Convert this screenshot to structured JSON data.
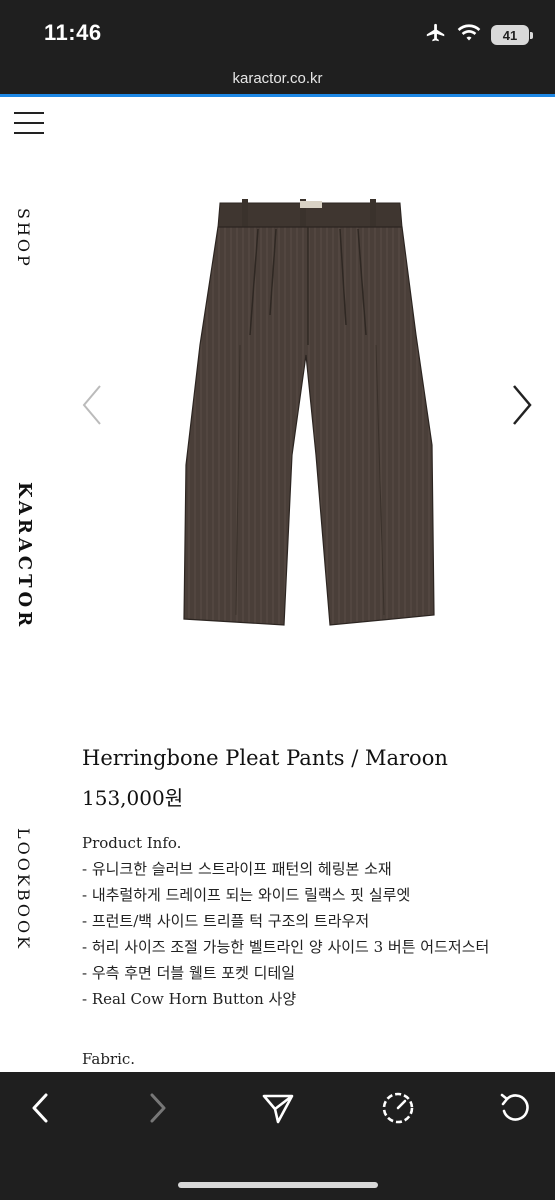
{
  "status_bar": {
    "time": "11:46",
    "battery": "41"
  },
  "browser": {
    "url": "karactor.co.kr"
  },
  "side_nav": {
    "shop": "SHOP",
    "brand": "KARACTOR",
    "lookbook": "LOOKBOOK"
  },
  "product": {
    "title": "Herringbone Pleat Pants / Maroon",
    "price": "153,000원",
    "info_heading": "Product Info.",
    "info_lines": [
      "- 유니크한 슬러브 스트라이프 패턴의 헤링본 소재",
      "- 내추럴하게 드레이프 되는 와이드 릴랙스 핏 실루엣",
      "- 프런트/백 사이드 트리플 턱 구조의 트라우저",
      "- 허리 사이즈 조절 가능한 벨트라인 양 사이드 3 버튼 어드저스터",
      "- 우측 후면 더블 웰트 포켓 디테일",
      "- Real Cow Horn Button 사양"
    ],
    "fabric_heading": "Fabric."
  },
  "icons": {
    "airplane": "airplane-icon",
    "wifi": "wifi-icon",
    "back": "chevron-left-icon",
    "forward": "chevron-right-icon",
    "share": "send-icon",
    "speed": "gauge-icon",
    "reload": "reload-icon"
  },
  "colors": {
    "accent_line": "#1e88e5",
    "bar_bg": "#1f1f1f",
    "pants": "#4a3f39"
  }
}
